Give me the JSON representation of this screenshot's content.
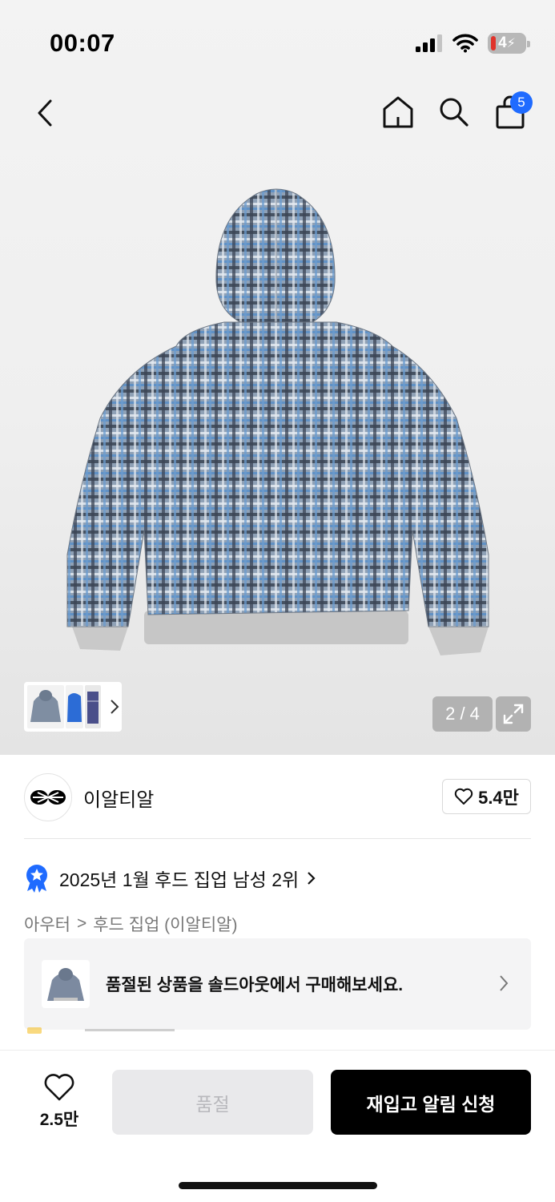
{
  "status_bar": {
    "time": "00:07",
    "battery": "4"
  },
  "nav": {
    "back_icon": "chevron-left-icon",
    "icons": [
      "home-icon",
      "search-icon",
      "shopping-bag-icon"
    ],
    "cart_count": "5",
    "badge_color": "#1f6bff"
  },
  "gallery": {
    "counter": "2 / 4",
    "thumbnail_count": 3
  },
  "brand": {
    "name": "이알티알",
    "likes": "5.4만"
  },
  "rank": {
    "text": "2025년 1월 후드 집업 남성 2위"
  },
  "category": {
    "items": [
      "아우터",
      "후드 집업 (이알티알)"
    ],
    "separator": ">"
  },
  "soldout_banner": {
    "text": "품절된 상품을 솔드아웃에서 구매해보세요."
  },
  "bottom_bar": {
    "wish_count": "2.5만",
    "soldout_label": "품절",
    "restock_label": "재입고 알림 신청"
  },
  "colors": {
    "accent": "#1f6bff",
    "cta_bg": "#000000",
    "disabled_bg": "#e9e9eb"
  }
}
